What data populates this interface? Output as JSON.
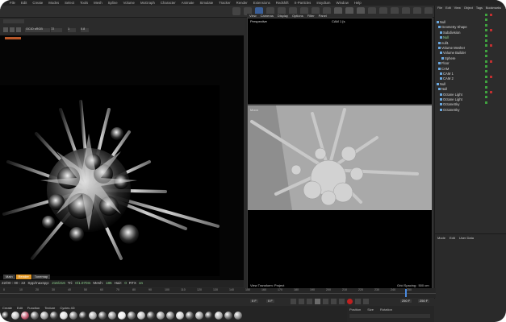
{
  "menubar": {
    "items": [
      "File",
      "Edit",
      "Create",
      "Modes",
      "Select",
      "Tools",
      "Mesh",
      "Spline",
      "Volume",
      "MoGraph",
      "Character",
      "Animate",
      "Simulate",
      "Tracker",
      "Render",
      "Extensions",
      "Redshift",
      "X-Particles",
      "Insydium",
      "Window",
      "Help"
    ]
  },
  "toolbar": {
    "accent_color": "#f5a623"
  },
  "left_toolbar": {
    "dropdown_value": "OCIO sRGB",
    "field_1": "72",
    "field_2": "1",
    "field_3": "0.8"
  },
  "render_view": {
    "tabs": [
      "Main",
      "Render",
      "Tonemap"
    ],
    "active_tab": "Render",
    "status_time": "22/00 : 00 : 22",
    "status_spp_label": "Spp/maxspp:",
    "status_spp_value": "216/216",
    "status_tri_label": "Tri:",
    "status_tri_value": "0/1.070m",
    "status_mesh_label": "Mesh:",
    "status_mesh_value": "185",
    "status_hair_label": "Hair:",
    "status_hair_value": "0",
    "status_engine_label": "RTX",
    "status_engine_value": "on"
  },
  "viewport_top": {
    "menu": [
      "View",
      "Cameras",
      "Display",
      "Options",
      "Filter",
      "Panel"
    ],
    "label": "Perspective",
    "camera": "CAM 1 [s"
  },
  "viewport_bottom": {
    "label": "Moon",
    "footer_left": "View Transform: Project",
    "footer_right": "Grid Spacing : 500 cm"
  },
  "object_manager": {
    "menu": [
      "File",
      "Edit",
      "View",
      "Object",
      "Tags",
      "Bookmarks"
    ],
    "items": [
      {
        "name": "Null",
        "color": "#d9d9d9"
      },
      {
        "name": "Geometry Shape",
        "color": "#d9d9d9"
      },
      {
        "name": "Subdivision",
        "color": "#d9d9d9"
      },
      {
        "name": "Null",
        "color": "#8fd18f"
      },
      {
        "name": "null1",
        "color": "#d9d9d9"
      },
      {
        "name": "Volume Mesher",
        "color": "#d9d9d9"
      },
      {
        "name": "Volume Builder",
        "color": "#d9d9d9"
      },
      {
        "name": "Sphere",
        "color": "#d9d9d9"
      },
      {
        "name": "Floor",
        "color": "#d9d9d9"
      },
      {
        "name": "CAM",
        "color": "#d9d9d9"
      },
      {
        "name": "CAM 1",
        "color": "#d9d9d9"
      },
      {
        "name": "CAM 2",
        "color": "#d9d9d9"
      },
      {
        "name": "Null",
        "color": "#d9d9d9"
      },
      {
        "name": "Null",
        "color": "#d9d9d9"
      },
      {
        "name": "Octane Light",
        "color": "#d9d9d9"
      },
      {
        "name": "Octane Light",
        "color": "#d9d9d9"
      },
      {
        "name": "OctaneSky",
        "color": "#d9d9d9"
      },
      {
        "name": "OctaneSky",
        "color": "#d9d9d9"
      }
    ]
  },
  "attribute_manager": {
    "menu": [
      "Mode",
      "Edit",
      "User Data"
    ]
  },
  "timeline": {
    "ticks": [
      "0",
      "10",
      "20",
      "30",
      "40",
      "50",
      "60",
      "70",
      "80",
      "90",
      "100",
      "110",
      "120",
      "130",
      "140",
      "150",
      "160",
      "170",
      "180",
      "190",
      "200",
      "210",
      "220",
      "230",
      "240",
      "250"
    ],
    "start_frame": "0 F",
    "end_frame": "250 F",
    "current_frame": "0 F",
    "right_frame": "250 F"
  },
  "material_bar": {
    "menu": [
      "Create",
      "Edit",
      "Function",
      "Texture",
      "Cycles 4D"
    ]
  },
  "coordinates": {
    "labels": [
      "Position",
      "Size",
      "Rotation"
    ]
  }
}
